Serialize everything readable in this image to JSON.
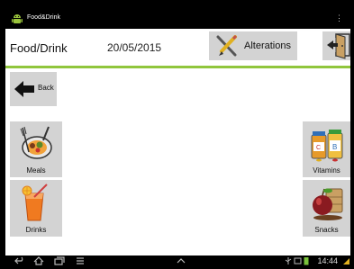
{
  "status_bar": {
    "app_title": "Food&Drink",
    "app_icon": "android-icon",
    "overflow_glyph": "⋮"
  },
  "header": {
    "title": "Food/Drink",
    "date": "20/05/2015",
    "alterations_label": "Alterations",
    "alterations_icon": "pencil-cross-icon",
    "exit_icon": "exit-door-icon"
  },
  "back": {
    "label": "Back",
    "icon": "back-arrow-icon"
  },
  "tiles": [
    {
      "label": "Meals",
      "icon": "meals-icon"
    },
    {
      "label": "Vitamins",
      "icon": "vitamins-icon"
    },
    {
      "label": "Drinks",
      "icon": "drinks-icon"
    },
    {
      "label": "Snacks",
      "icon": "snacks-icon"
    }
  ],
  "nav_bar": {
    "clock": "14:44",
    "icons": [
      "back-nav-icon",
      "home-nav-icon",
      "recents-nav-icon",
      "menu-nav-icon",
      "up-chevron-icon"
    ]
  },
  "colors": {
    "accent_line": "#90c63c",
    "button_bg": "#d3d3d3",
    "system_bar": "#000000"
  }
}
